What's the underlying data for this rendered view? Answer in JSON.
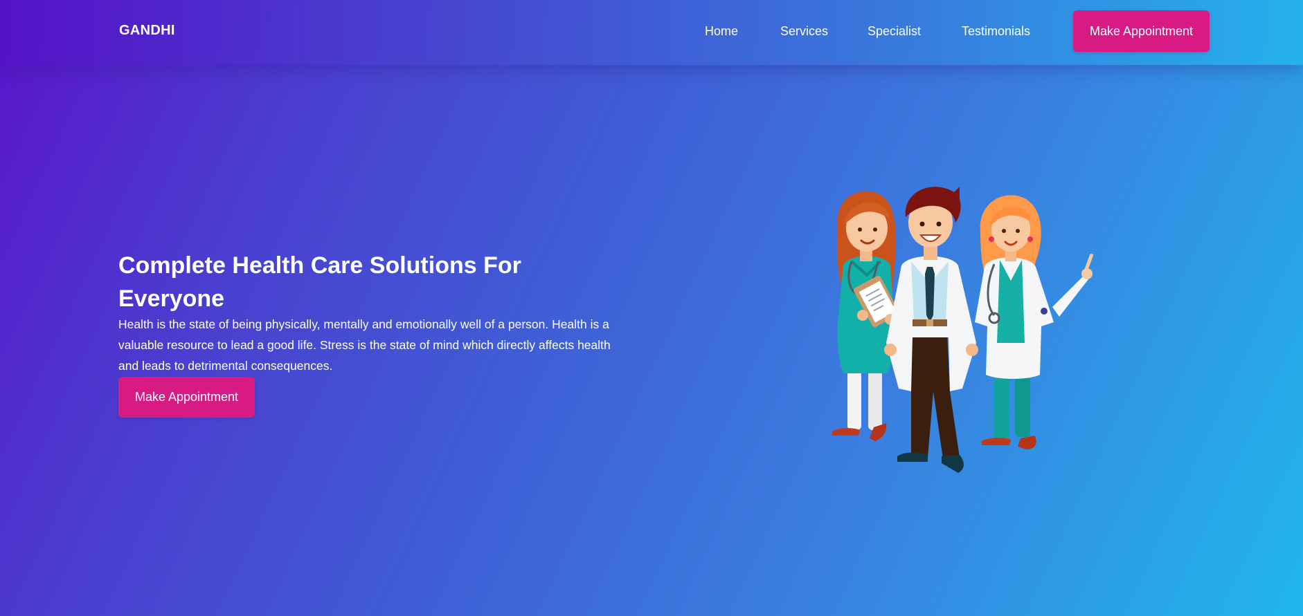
{
  "nav": {
    "brand": "GANDHI",
    "links": [
      "Home",
      "Services",
      "Specialist",
      "Testimonials"
    ],
    "cta": "Make Appointment"
  },
  "hero": {
    "title": "Complete Health Care Solutions For Everyone",
    "description": "Health is the state of being physically, mentally and emotionally well of a person. Health is a valuable resource to lead a good life. Stress is the state of mind which directly affects health and leads to detrimental consequences.",
    "cta": "Make Appointment"
  },
  "colors": {
    "accent": "#d81b84",
    "gradient_start": "#5a14c9",
    "gradient_end": "#20b6ec"
  },
  "icons": {
    "illustration": "three-doctors-illustration"
  }
}
